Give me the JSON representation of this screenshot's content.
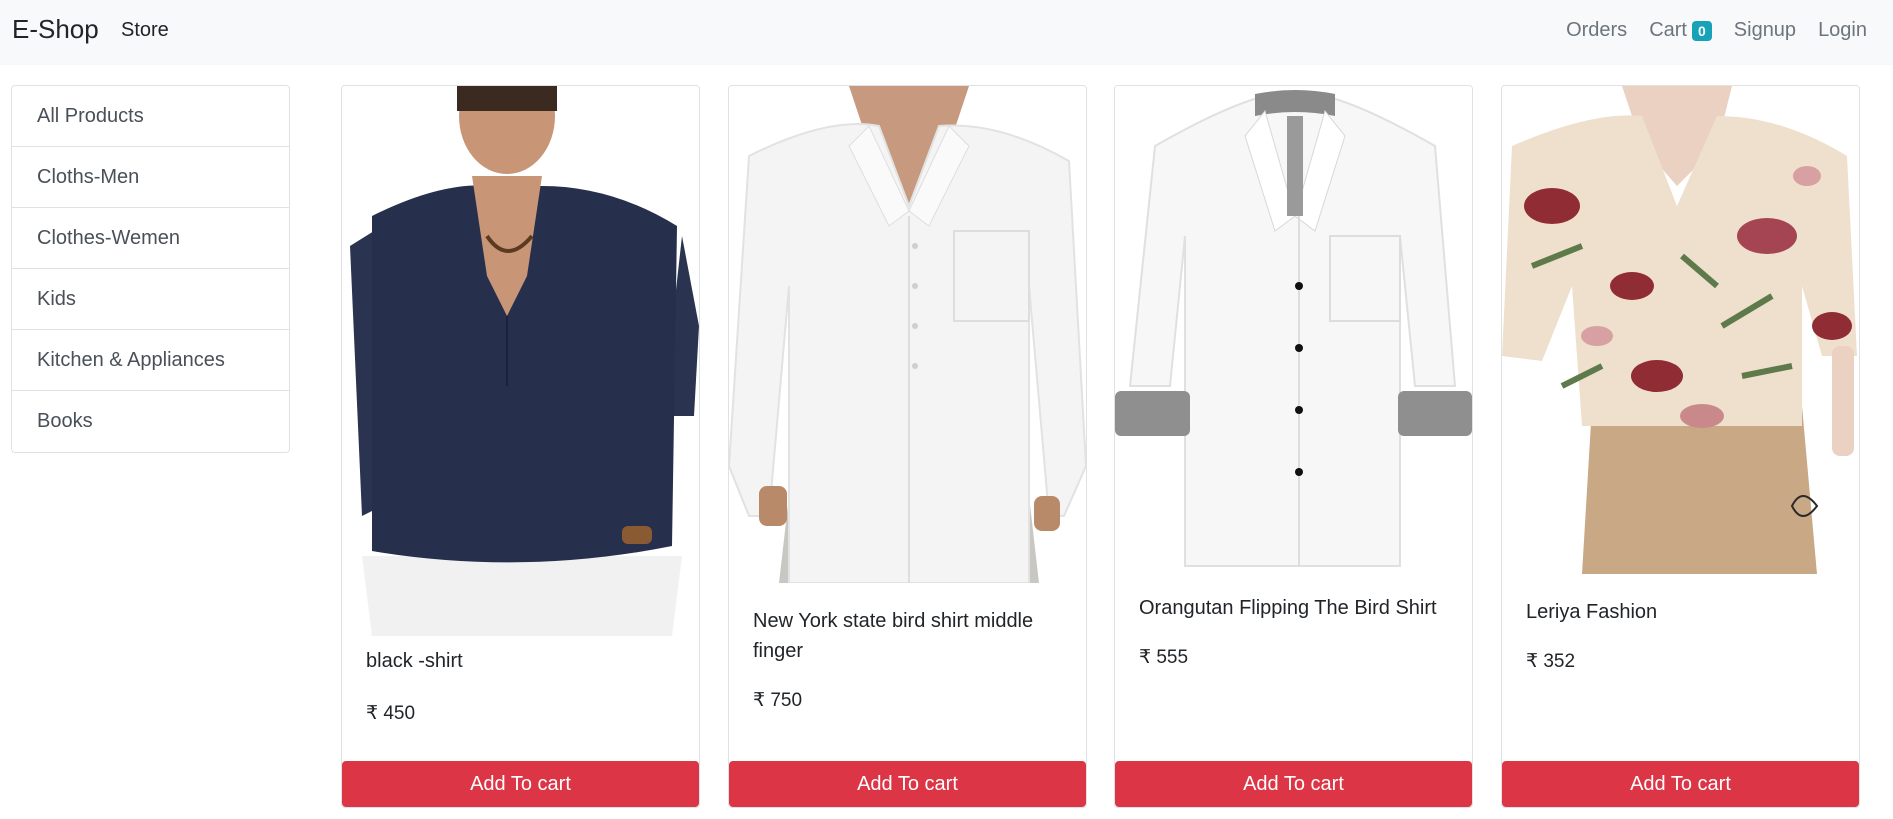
{
  "navbar": {
    "brand": "E-Shop",
    "store": "Store",
    "orders": "Orders",
    "cart": "Cart",
    "cart_count": "0",
    "signup": "Signup",
    "login": "Login"
  },
  "categories": [
    {
      "label": "All Products"
    },
    {
      "label": "Cloths-Men"
    },
    {
      "label": "Clothes-Wemen"
    },
    {
      "label": "Kids"
    },
    {
      "label": "Kitchen & Appliances"
    },
    {
      "label": "Books"
    }
  ],
  "products": [
    {
      "name": "black -shirt",
      "price": "₹ 450",
      "button": "Add To cart",
      "image": "navy-henley-shirt-photo"
    },
    {
      "name": "New York state bird shirt middle finger",
      "price": "₹ 750",
      "button": "Add To cart",
      "image": "white-shirt-photo"
    },
    {
      "name": "Orangutan Flipping The Bird Shirt",
      "price": "₹ 555",
      "button": "Add To cart",
      "image": "white-dress-shirt-photo"
    },
    {
      "name": "Leriya Fashion",
      "price": "₹ 352",
      "button": "Add To cart",
      "image": "floral-blouse-photo"
    }
  ],
  "colors": {
    "navbar_bg": "#f8f9fa",
    "badge": "#17a2b8",
    "button": "#dc3545"
  }
}
